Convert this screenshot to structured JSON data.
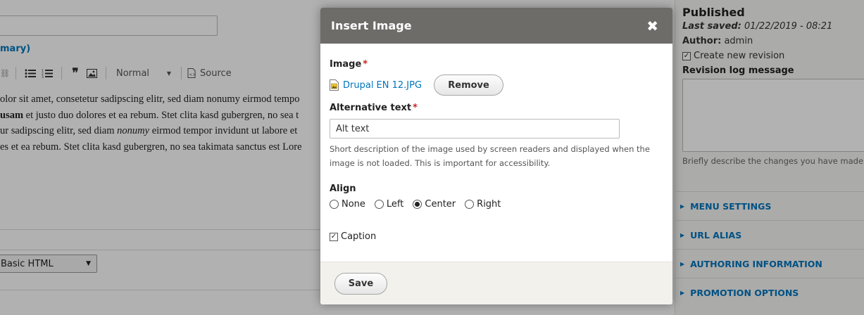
{
  "background": {
    "summary_link": "mary)",
    "toolbar": {
      "format_value": "Normal",
      "source_label": "Source"
    },
    "body_lines": [
      "olor sit amet, consetetur sadipscing elitr, sed diam nonumy eirmod tempo",
      "et justo duo dolores et ea rebum. Stet clita kasd gubergren, no sea t",
      "sed diam eirmod tempor invidunt ut labore et",
      "es et ea rebum. Stet clita kasd gubergren, no sea takimata sanctus est Lore"
    ],
    "body_line2_bold": "usam",
    "body_line3_start": "ur sadipscing elitr, sed diam ",
    "body_line3_em": "nonumy",
    "body_line3_end": " eirmod tempor invidunt ut labore et",
    "text_format_value": "Basic HTML"
  },
  "sidebar": {
    "status": "Published",
    "last_saved_label": "Last saved:",
    "last_saved_value": "01/22/2019 - 08:21",
    "author_label": "Author:",
    "author_value": "admin",
    "create_revision_label": "Create new revision",
    "create_revision_checked": true,
    "revision_log_label": "Revision log message",
    "revision_log_help": "Briefly describe the changes you have made",
    "sections": [
      "MENU SETTINGS",
      "URL ALIAS",
      "AUTHORING INFORMATION",
      "PROMOTION OPTIONS"
    ]
  },
  "dialog": {
    "title": "Insert Image",
    "close_glyph": "✖",
    "image_label": "Image",
    "required_marker": "*",
    "file_name": "Drupal EN 12.JPG",
    "remove_label": "Remove",
    "alt_label": "Alternative text",
    "alt_value": "Alt text",
    "alt_help_line1": "Short description of the image used by screen readers and displayed when the",
    "alt_help_line2": "image is not loaded. This is important for accessibility.",
    "align_label": "Align",
    "align_options": [
      "None",
      "Left",
      "Center",
      "Right"
    ],
    "align_selected": "Center",
    "caption_label": "Caption",
    "caption_checked": true,
    "save_label": "Save"
  },
  "colors": {
    "link": "#0074bd",
    "titlebar": "#6e6c68",
    "required": "#cc2222"
  }
}
